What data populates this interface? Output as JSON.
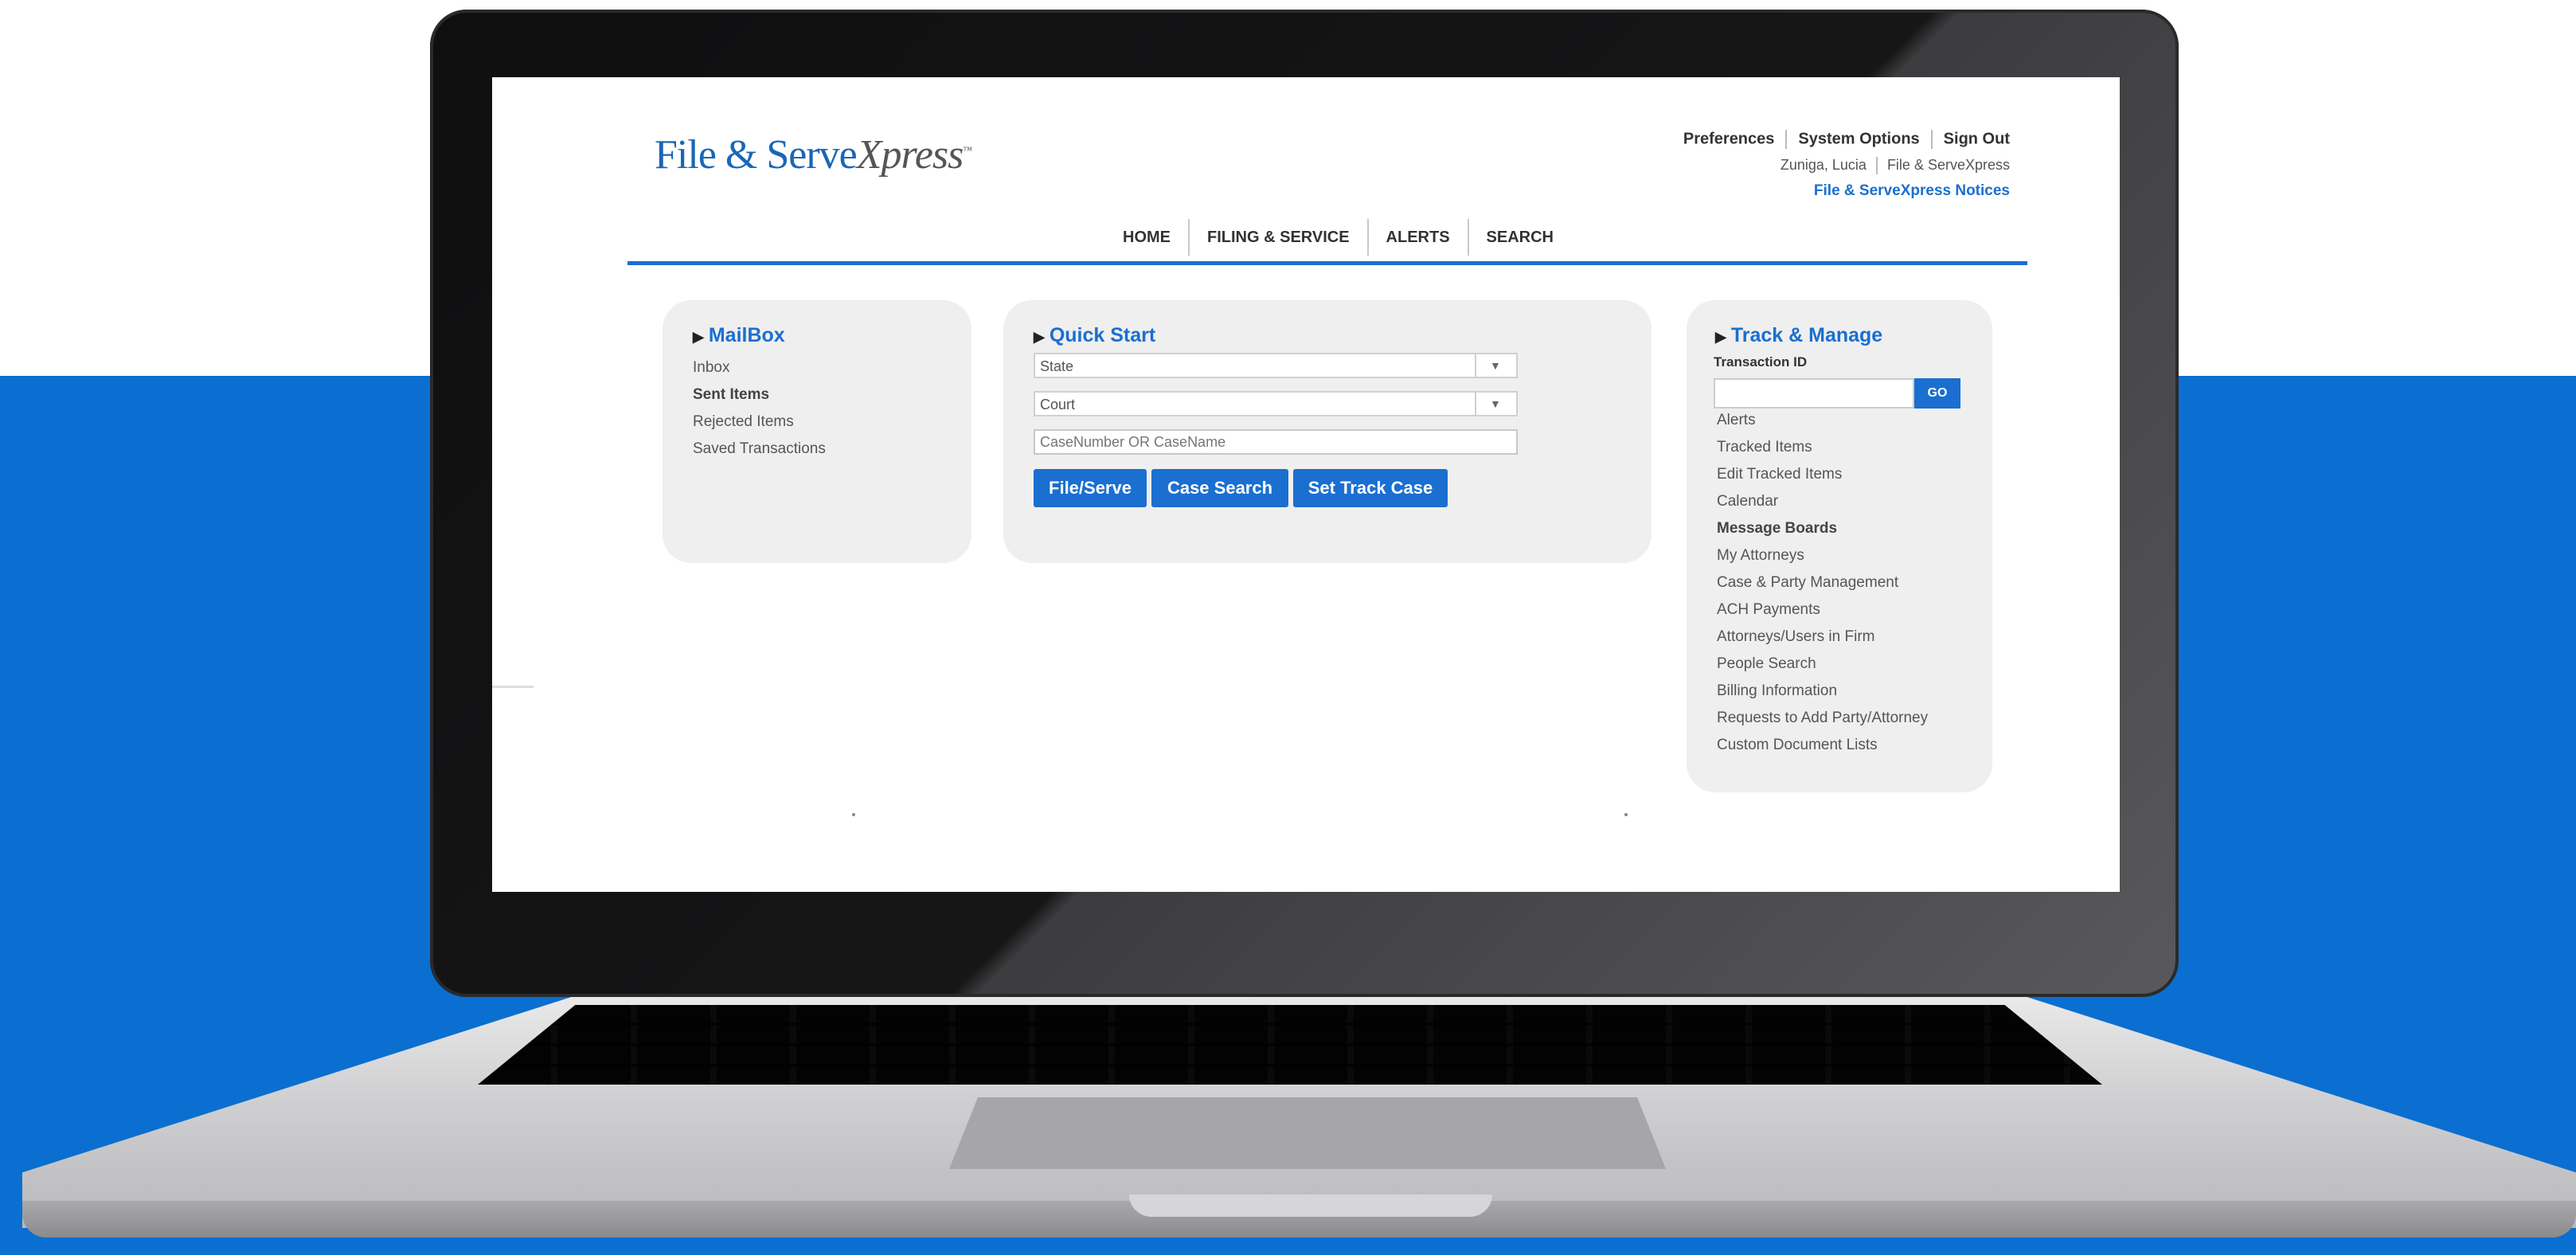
{
  "logo": {
    "main": "File & Serve",
    "x": "Xpress",
    "tm": "™"
  },
  "topnav": {
    "preferences": "Preferences",
    "system_options": "System Options",
    "sign_out": "Sign Out"
  },
  "user": {
    "name": "Zuniga, Lucia",
    "org": "File & ServeXpress"
  },
  "notices": "File & ServeXpress Notices",
  "mainnav": [
    "HOME",
    "FILING & SERVICE",
    "ALERTS",
    "SEARCH"
  ],
  "mailbox": {
    "title": "MailBox",
    "items": [
      "Inbox",
      "Sent Items",
      "Rejected Items",
      "Saved Transactions"
    ]
  },
  "quick_start": {
    "title": "Quick Start",
    "state": "State",
    "court": "Court",
    "case_placeholder": "CaseNumber OR CaseName",
    "buttons": [
      "File/Serve",
      "Case Search",
      "Set Track Case"
    ]
  },
  "track": {
    "title": "Track & Manage",
    "tid_label": "Transaction ID",
    "go": "GO",
    "items": [
      "Alerts",
      "Tracked Items",
      "Edit Tracked Items",
      "Calendar",
      "Message Boards",
      "My Attorneys",
      "Case & Party Management",
      "ACH Payments",
      "Attorneys/Users in Firm",
      "People Search",
      "Billing Information",
      "Requests to Add Party/Attorney",
      "Custom Document Lists"
    ]
  },
  "colors": {
    "accent": "#1a6fd0",
    "background_blue": "#0a6fd0"
  }
}
